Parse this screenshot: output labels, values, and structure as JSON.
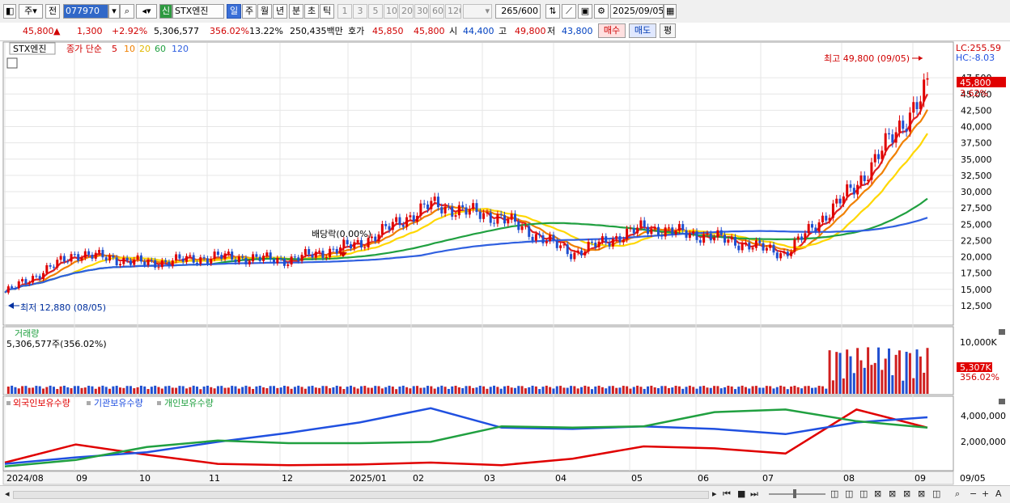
{
  "toolbar": {
    "period_type": "주",
    "prev_label": "전",
    "code": "077970",
    "market_badge": "신",
    "stock_name": "STX엔진",
    "periods": [
      "일",
      "주",
      "월",
      "년",
      "분",
      "초",
      "틱"
    ],
    "active_period": "일",
    "intervals": [
      "1",
      "3",
      "5",
      "10",
      "20",
      "30",
      "60",
      "120"
    ],
    "count": "265",
    "count_max": "/600",
    "date": "2025/09/05"
  },
  "quote": {
    "price": "45,800",
    "arrow": "▲",
    "change": "1,300",
    "change_pct": "+2.92%",
    "volume": "5,306,577",
    "volume_ratio": "356.02%",
    "turnover": "13.22%",
    "amount": "250,435백만",
    "ask_label": "호가",
    "ask": "45,850",
    "bid": "45,800",
    "open_label": "시",
    "open": "44,400",
    "high_label": "고",
    "high": "49,800",
    "low_label": "저",
    "low": "43,800",
    "buy_label": "매수",
    "sell_label": "매도",
    "avg_label": "평"
  },
  "main_legend": {
    "name": "STX엔진",
    "label": "종가 단순",
    "ma_periods": [
      "5",
      "10",
      "20",
      "60",
      "120"
    ],
    "ma_colors": [
      "#e02020",
      "#f08000",
      "#ffd700",
      "#20a040",
      "#3060e0"
    ]
  },
  "price_panel": {
    "lc_label": "LC:255.59",
    "hc_label": "HC:-8.03",
    "current_tag": "45,800",
    "current_pct": "3.62%",
    "high_note": "최고 49,800 (09/05)",
    "low_note": "최저 12,880 (08/05)",
    "dividend_note": "배당락(0.00%)"
  },
  "volume_panel": {
    "title": "거래량",
    "summary": "5,306,577주(356.02%)",
    "axis_label": "10,000K",
    "current_tag": "5,307K",
    "current_pct": "356.02%"
  },
  "holdings_panel": {
    "legend": [
      "외국인보유수량",
      "기관보유수량",
      "개인보유수량"
    ],
    "colors": [
      "#e00000",
      "#2050e0",
      "#20a040"
    ],
    "axis_labels": [
      "4,000,000",
      "2,000,000"
    ]
  },
  "x_axis": [
    "2024/08",
    "09",
    "10",
    "11",
    "12",
    "2025/01",
    "02",
    "03",
    "04",
    "05",
    "06",
    "07",
    "08",
    "09",
    "09/05"
  ],
  "chart_data": [
    {
      "type": "candlestick",
      "title": "STX엔진",
      "y_ticks": [
        12500,
        15000,
        17500,
        20000,
        22500,
        25000,
        27500,
        30000,
        32500,
        35000,
        37500,
        40000,
        42500,
        45000,
        47500
      ],
      "ylim": [
        11000,
        50500
      ],
      "grid": true,
      "monthly_close": {
        "x": [
          "2024/08",
          "09",
          "10",
          "11",
          "12",
          "2025/01",
          "02",
          "03",
          "04",
          "05",
          "06",
          "07",
          "08",
          "09/05"
        ],
        "close": [
          14500,
          20500,
          19000,
          20000,
          19500,
          22000,
          28000,
          26000,
          20500,
          24500,
          23000,
          20500,
          31000,
          45800
        ]
      },
      "ma_periods": [
        5,
        10,
        20,
        60,
        120
      ],
      "annotations": [
        {
          "text": "최고 49,800 (09/05)",
          "x": "09/05",
          "y": 49800
        },
        {
          "text": "최저 12,880 (08/05)",
          "x": "08/05",
          "y": 12880
        },
        {
          "text": "배당락(0.00%)",
          "x": "2024/12",
          "y": 20500
        }
      ]
    },
    {
      "type": "bar",
      "title": "거래량",
      "y_ticks": [
        "10,000K"
      ],
      "last_value": "5,307K"
    },
    {
      "type": "line",
      "series": [
        {
          "name": "외국인보유수량",
          "color": "#e00000",
          "values": [
            500000,
            1900000,
            1100000,
            400000,
            300000,
            350000,
            500000,
            300000,
            800000,
            1750000,
            1600000,
            1200000,
            4600000,
            3200000
          ]
        },
        {
          "name": "기관보유수량",
          "color": "#2050e0",
          "values": [
            400000,
            900000,
            1300000,
            2100000,
            2800000,
            3600000,
            4700000,
            3200000,
            3100000,
            3300000,
            3100000,
            2700000,
            3600000,
            4000000
          ]
        },
        {
          "name": "개인보유수량",
          "color": "#20a040",
          "values": [
            200000,
            700000,
            1700000,
            2200000,
            2000000,
            2000000,
            2100000,
            3300000,
            3200000,
            3300000,
            4400000,
            4600000,
            3700000,
            3200000
          ]
        }
      ],
      "y_ticks": [
        2000000,
        4000000
      ]
    }
  ]
}
